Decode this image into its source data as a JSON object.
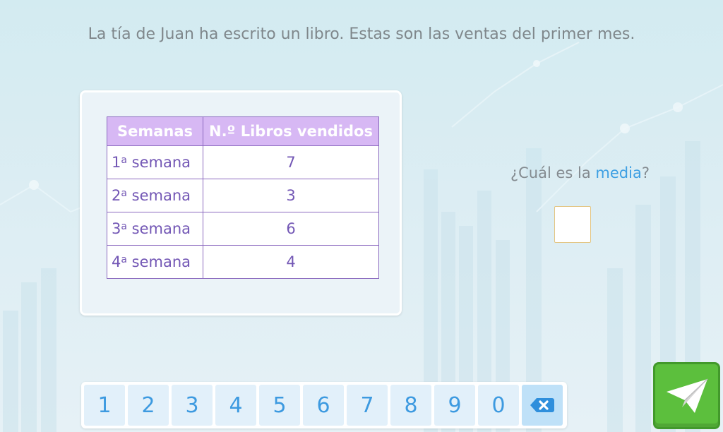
{
  "prompt": "La tía de Juan ha escrito un libro. Estas son las ventas del primer mes.",
  "table": {
    "headers": [
      "Semanas",
      "N.º Libros vendidos"
    ],
    "rows": [
      {
        "num": "1",
        "sup": "a",
        "label": "semana",
        "value": "7"
      },
      {
        "num": "2",
        "sup": "a",
        "label": "semana",
        "value": "3"
      },
      {
        "num": "3",
        "sup": "a",
        "label": "semana",
        "value": "6"
      },
      {
        "num": "4",
        "sup": "a",
        "label": "semana",
        "value": "4"
      }
    ]
  },
  "question": {
    "before": "¿Cuál es la ",
    "highlight": "media",
    "after": "?"
  },
  "answer": {
    "value": ""
  },
  "keypad": {
    "keys": [
      "1",
      "2",
      "3",
      "4",
      "5",
      "6",
      "7",
      "8",
      "9",
      "0"
    ],
    "delete_icon": "backspace-icon"
  },
  "send_button": {
    "icon": "paper-plane-icon"
  },
  "colors": {
    "header_bg": "#d7b8f4",
    "table_border": "#8b6abf",
    "cell_text": "#7357b5",
    "highlight": "#3ea0e3",
    "send_green": "#5cbf3d",
    "key_bg": "#e2f0fa",
    "key_text": "#3d9ae0"
  }
}
